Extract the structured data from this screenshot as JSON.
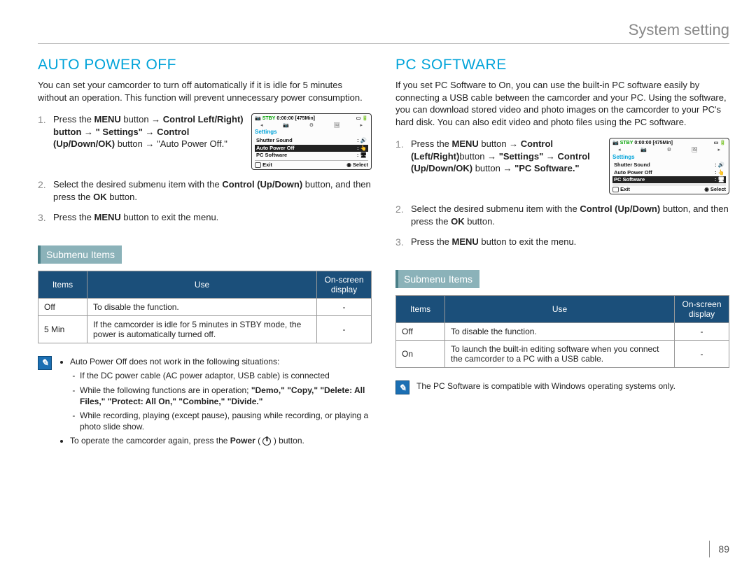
{
  "header": {
    "title": "System setting"
  },
  "page_number": "89",
  "left": {
    "title": "AUTO POWER OFF",
    "intro": "You can set your camcorder to turn off automatically if it is idle for 5 minutes without an operation. This function will prevent unnecessary power consumption.",
    "steps": {
      "s1_a": "Press the ",
      "s1_b": "MENU",
      "s1_c": " button → ",
      "s1_d": "Control Left/Right)",
      "s1_e": " button → \" Settings\" → Control (Up/Down/OK)",
      "s1_f": " button → \"Auto Power Off.\"",
      "s2_a": "Select the desired submenu item with the ",
      "s2_b": "Control (Up/Down)",
      "s2_c": " button, and then press the ",
      "s2_d": "OK",
      "s2_e": " button.",
      "s3_a": "Press the ",
      "s3_b": "MENU",
      "s3_c": " button to exit the menu."
    },
    "lcd": {
      "stby": "STBY",
      "time": "0:00:00",
      "remain": "[475Min]",
      "settings": "Settings",
      "item1": "Shutter Sound",
      "item2": "Auto Power Off",
      "item3": "PC Software",
      "menu": "MENU",
      "exit": "Exit",
      "select": "Select"
    },
    "submenu_label": "Submenu Items",
    "table": {
      "h1": "Items",
      "h2": "Use",
      "h3": "On-screen display",
      "r1c1": "Off",
      "r1c2": "To disable the function.",
      "r1c3": "-",
      "r2c1": "5 Min",
      "r2c2": "If the camcorder is idle for 5 minutes in STBY mode, the power is automatically turned off.",
      "r2c3": "-"
    },
    "notes": {
      "n1": "Auto Power Off does not work in the following situations:",
      "n1a": "If the DC power cable (AC power adaptor, USB cable) is connected",
      "n1b_a": "While the following functions are in operation; ",
      "n1b_b": "\"Demo,\" \"Copy,\" \"Delete: All Files,\" \"Protect: All On,\" \"Combine,\" \"Divide.\"",
      "n1c": "While recording, playing (except pause), pausing while recording, or playing a photo slide show.",
      "n2_a": "To operate the camcorder again, press the ",
      "n2_b": "Power",
      "n2_c": " ( ",
      "n2_d": " ) button."
    }
  },
  "right": {
    "title": "PC SOFTWARE",
    "intro": "If you set PC Software to On, you can use the built-in PC software easily by connecting a USB cable between the camcorder and your PC. Using the software, you can download stored video and photo images on the camcorder to your PC's hard disk. You can also edit video and photo files using the PC software.",
    "steps": {
      "s1_a": "Press the ",
      "s1_b": "MENU",
      "s1_c": " button → ",
      "s1_d": "Control (Left/Right)",
      "s1_e": "button → ",
      "s1_f": "\"Settings\"",
      "s1_g": " → ",
      "s1_h": "Control (Up/Down/OK)",
      "s1_i": " button → ",
      "s1_j": "\"PC Software.\"",
      "s2_a": "Select the desired submenu item with the ",
      "s2_b": "Control (Up/Down)",
      "s2_c": " button, and then press the ",
      "s2_d": "OK",
      "s2_e": " button.",
      "s3_a": "Press the ",
      "s3_b": "MENU",
      "s3_c": " button to exit the menu."
    },
    "lcd": {
      "stby": "STBY",
      "time": "0:00:00",
      "remain": "[475Min]",
      "settings": "Settings",
      "item1": "Shutter Sound",
      "item2": "Auto Power Off",
      "item3": "PC Software",
      "menu": "MENU",
      "exit": "Exit",
      "select": "Select"
    },
    "submenu_label": "Submenu Items",
    "table": {
      "h1": "Items",
      "h2": "Use",
      "h3": "On-screen display",
      "r1c1": "Off",
      "r1c2": "To disable the function.",
      "r1c3": "-",
      "r2c1": "On",
      "r2c2": "To launch the built-in editing software when you connect the camcorder to a PC with a USB cable.",
      "r2c3": "-"
    },
    "note": "The PC Software is compatible with Windows operating systems only."
  }
}
